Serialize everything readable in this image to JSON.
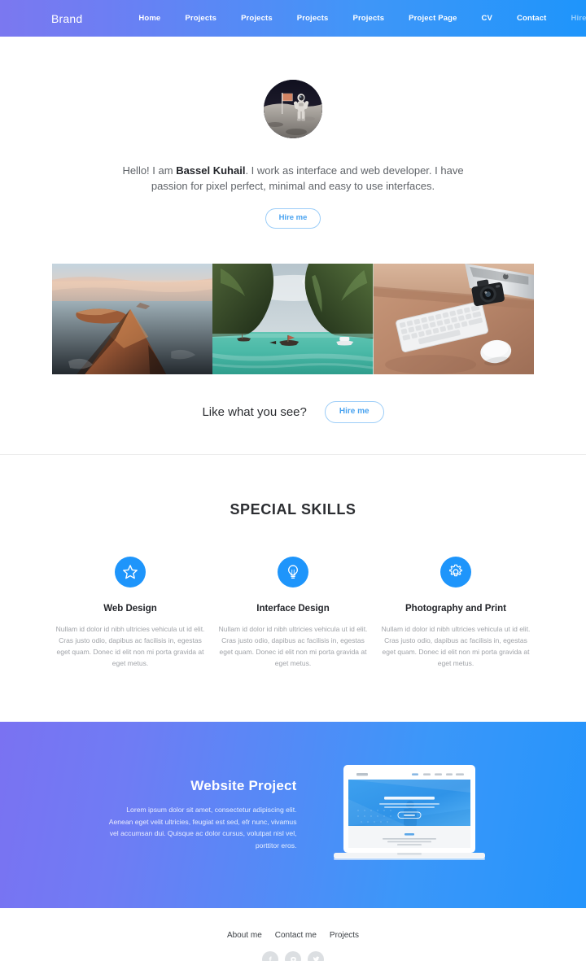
{
  "nav": {
    "brand": "Brand",
    "links": [
      {
        "label": "Home",
        "muted": false
      },
      {
        "label": "Projects",
        "muted": false
      },
      {
        "label": "Projects",
        "muted": false
      },
      {
        "label": "Projects",
        "muted": false
      },
      {
        "label": "Projects",
        "muted": false
      },
      {
        "label": "Project Page",
        "muted": false
      },
      {
        "label": "CV",
        "muted": false
      },
      {
        "label": "Contact",
        "muted": false
      },
      {
        "label": "Hire me",
        "muted": true
      }
    ],
    "gradient_from": "#7b78f0",
    "gradient_to": "#1e95fb"
  },
  "hero": {
    "avatar_name": "astronaut-on-moon-photo",
    "greeting_prefix": "Hello! I am ",
    "name": "Bassel Kuhail",
    "greeting_suffix": ". I work as interface and web developer. I have passion for pixel perfect, minimal and easy to use interfaces.",
    "cta_label": "Hire me"
  },
  "gallery": {
    "images": [
      {
        "alt": "coastal-cliff-at-sunset-photo"
      },
      {
        "alt": "tropical-bay-with-longtail-boats-photo"
      },
      {
        "alt": "desk-with-imac-keyboard-and-camera-photo"
      }
    ]
  },
  "like_bar": {
    "title": "Like what you see?",
    "cta_label": "Hire me"
  },
  "skills": {
    "heading": "SPECIAL SKILLS",
    "items": [
      {
        "icon": "star-icon",
        "title": "Web Design",
        "desc": "Nullam id dolor id nibh ultricies vehicula ut id elit. Cras justo odio, dapibus ac facilisis in, egestas eget quam. Donec id elit non mi porta gravida at eget metus."
      },
      {
        "icon": "lightbulb-icon",
        "title": "Interface Design",
        "desc": "Nullam id dolor id nibh ultricies vehicula ut id elit. Cras justo odio, dapibus ac facilisis in, egestas eget quam. Donec id elit non mi porta gravida at eget metus."
      },
      {
        "icon": "gear-icon",
        "title": "Photography and Print",
        "desc": "Nullam id dolor id nibh ultricies vehicula ut id elit. Cras justo odio, dapibus ac facilisis in, egestas eget quam. Donec id elit non mi porta gravida at eget metus."
      }
    ],
    "icon_color": "#1e95fb"
  },
  "project": {
    "title": "Website Project",
    "desc": "Lorem ipsum dolor sit amet, consectetur adipiscing elit. Aenean eget velit ultricies, feugiat est sed, efr nunc, vivamus vel accumsan dui. Quisque ac dolor cursus, volutpat nisl vel, porttitor eros.",
    "mockup_name": "laptop-website-mockup",
    "gradient_from": "#7a72f2",
    "gradient_to": "#2494fb"
  },
  "footer": {
    "links": [
      {
        "label": "About me"
      },
      {
        "label": "Contact me"
      },
      {
        "label": "Projects"
      }
    ],
    "socials": [
      {
        "name": "facebook-icon"
      },
      {
        "name": "instagram-icon"
      },
      {
        "name": "twitter-icon"
      }
    ]
  }
}
